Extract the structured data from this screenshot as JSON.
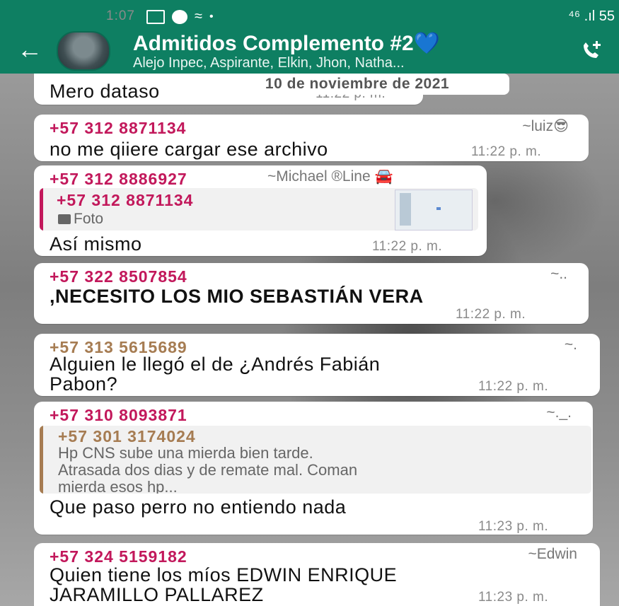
{
  "status_bar": {
    "time": "1:07",
    "right": "⁴⁶ .ıl 55"
  },
  "header": {
    "title": "Admitidos Complemento #2",
    "title_emoji": "💙",
    "subtitle": "Alejo Inpec, Aspirante, Elkin, Jhon, Natha...",
    "icons": [
      "back-arrow-icon",
      "group-avatar",
      "add-call-icon"
    ]
  },
  "date_chip": "10 de noviembre de 2021",
  "messages": [
    {
      "text": "Mero dataso",
      "time": "11:22 p. m."
    },
    {
      "sender": "+57 312 8871134",
      "alias": "~luiz😎",
      "text": "no me qiiere cargar ese archivo",
      "time": "11:22 p. m."
    },
    {
      "sender": "+57 312 8886927",
      "alias": "~Michael ®Line 🚘",
      "quote_sender": "+57 312 8871134",
      "quote_text": "Foto",
      "text": "Así mismo",
      "time": "11:22 p. m."
    },
    {
      "sender": "+57 322 8507854",
      "alias": "~..",
      "text": ",NECESITO LOS MIO SEBASTIÁN VERA",
      "time": "11:22 p. m."
    },
    {
      "sender": "+57 313 5615689",
      "alias": "~.",
      "text_line1": "Alguien le llegó el de ¿Andrés Fabián",
      "text_line2": "Pabon?",
      "time": "11:22 p. m."
    },
    {
      "sender": "+57 310 8093871",
      "alias": "~._.",
      "quote_sender": "+57 301 3174024",
      "quote_line1": "Hp CNS sube una mierda bien tarde.",
      "quote_line2": "Atrasada dos dias y de remate mal. Coman",
      "quote_line3": "mierda esos hp...",
      "text": "Que paso perro no entiendo nada",
      "time": "11:23 p. m."
    },
    {
      "sender": "+57 324 5159182",
      "alias": "~Edwin",
      "text_line1": "Quien tiene los míos EDWIN ENRIQUE",
      "text_line2": "JARAMILLO PALLAREZ",
      "time": "11:23 p. m."
    }
  ],
  "colors": {
    "header": "#0e7f62",
    "sender_pink": "#c2185b",
    "sender_brown": "#a67c52"
  }
}
